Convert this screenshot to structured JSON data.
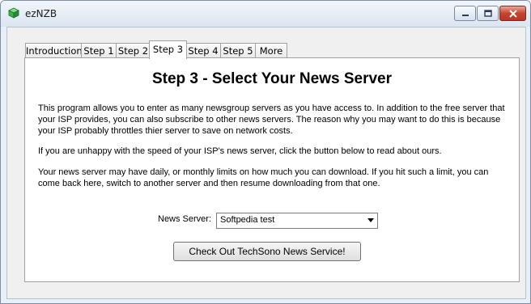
{
  "window": {
    "title": "ezNZB",
    "accent": "#7a8ea8",
    "close_color": "#c5442f"
  },
  "tabs": [
    {
      "label": "Introduction"
    },
    {
      "label": "Step 1"
    },
    {
      "label": "Step 2"
    },
    {
      "label": "Step 3",
      "active": true
    },
    {
      "label": "Step 4"
    },
    {
      "label": "Step 5"
    },
    {
      "label": "More"
    }
  ],
  "content": {
    "heading": "Step 3 - Select Your News Server",
    "paragraph1": "This program allows you to enter as many newsgroup servers as you have access to. In addition to the free server that your ISP provides, you can also subscribe to other news servers. The reason why you may want to do this is because your ISP probably throttles thier server to save on network costs.",
    "paragraph2": "If you are unhappy with the speed of your ISP's news server, click the button below to read about ours.",
    "paragraph3": "Your news server may have daily, or monthly limits on how much you can download. If you hit such a limit, you can come back here, switch to another server and then resume downloading from that one.",
    "news_server_label": "News Server:",
    "news_server_value": "Softpedia test",
    "button_label": "Check Out TechSono News Service!"
  }
}
